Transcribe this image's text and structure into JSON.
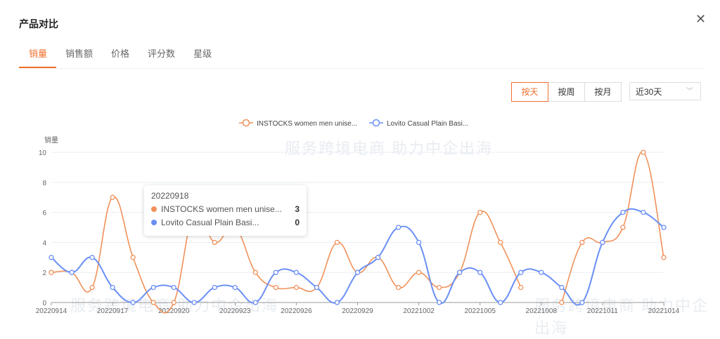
{
  "dialog": {
    "title": "产品对比",
    "close_icon": "close-icon"
  },
  "tabs": [
    {
      "label": "销量",
      "active": true
    },
    {
      "label": "销售额"
    },
    {
      "label": "价格"
    },
    {
      "label": "评分数"
    },
    {
      "label": "星级"
    }
  ],
  "granularity": [
    {
      "label": "按天",
      "active": true
    },
    {
      "label": "按周"
    },
    {
      "label": "按月"
    }
  ],
  "range_select": {
    "value": "近30天"
  },
  "watermark": "服务跨境电商 助力中企出海",
  "tooltip": {
    "date": "20220918",
    "rows": [
      {
        "name": "INSTOCKS women men unise...",
        "value": "3"
      },
      {
        "name": "Lovito Casual Plain Basi...",
        "value": "0"
      }
    ]
  },
  "chart_data": {
    "type": "line",
    "ylabel": "销量",
    "ylim": [
      0,
      10
    ],
    "yticks": [
      "0",
      "2",
      "4",
      "6",
      "8",
      "10"
    ],
    "grid": true,
    "legend_position": "top-center",
    "x": [
      "20220914",
      "20220915",
      "20220916",
      "20220917",
      "20220918",
      "20220919",
      "20220920",
      "20220921",
      "20220922",
      "20220923",
      "20220924",
      "20220925",
      "20220926",
      "20220927",
      "20220928",
      "20220929",
      "20220930",
      "20221001",
      "20221002",
      "20221003",
      "20221004",
      "20221005",
      "20221006",
      "20221007",
      "20221008",
      "20221009",
      "20221010",
      "20221011",
      "20221012",
      "20221013",
      "20221014"
    ],
    "xtick_labels": [
      "20220914",
      "20220917",
      "20220920",
      "20220923",
      "20220926",
      "20220929",
      "20221002",
      "20221005",
      "20221008",
      "20221011",
      "20221014"
    ],
    "series": [
      {
        "name": "INSTOCKS women men unise...",
        "color": "#f0915a",
        "values": [
          2,
          2,
          1,
          7,
          3,
          0,
          0,
          6,
          4,
          5,
          2,
          1,
          1,
          1,
          4,
          2,
          3,
          1,
          2,
          1,
          2,
          6,
          4,
          1,
          null,
          0,
          4,
          4,
          5,
          10,
          3
        ]
      },
      {
        "name": "Lovito Casual Plain Basi...",
        "color": "#6a8ff5",
        "values": [
          3,
          2,
          3,
          1,
          0,
          1,
          1,
          0,
          1,
          1,
          0,
          2,
          2,
          1,
          0,
          2,
          3,
          5,
          4,
          0,
          2,
          2,
          0,
          2,
          2,
          1,
          0,
          4,
          6,
          6,
          5
        ]
      }
    ]
  }
}
